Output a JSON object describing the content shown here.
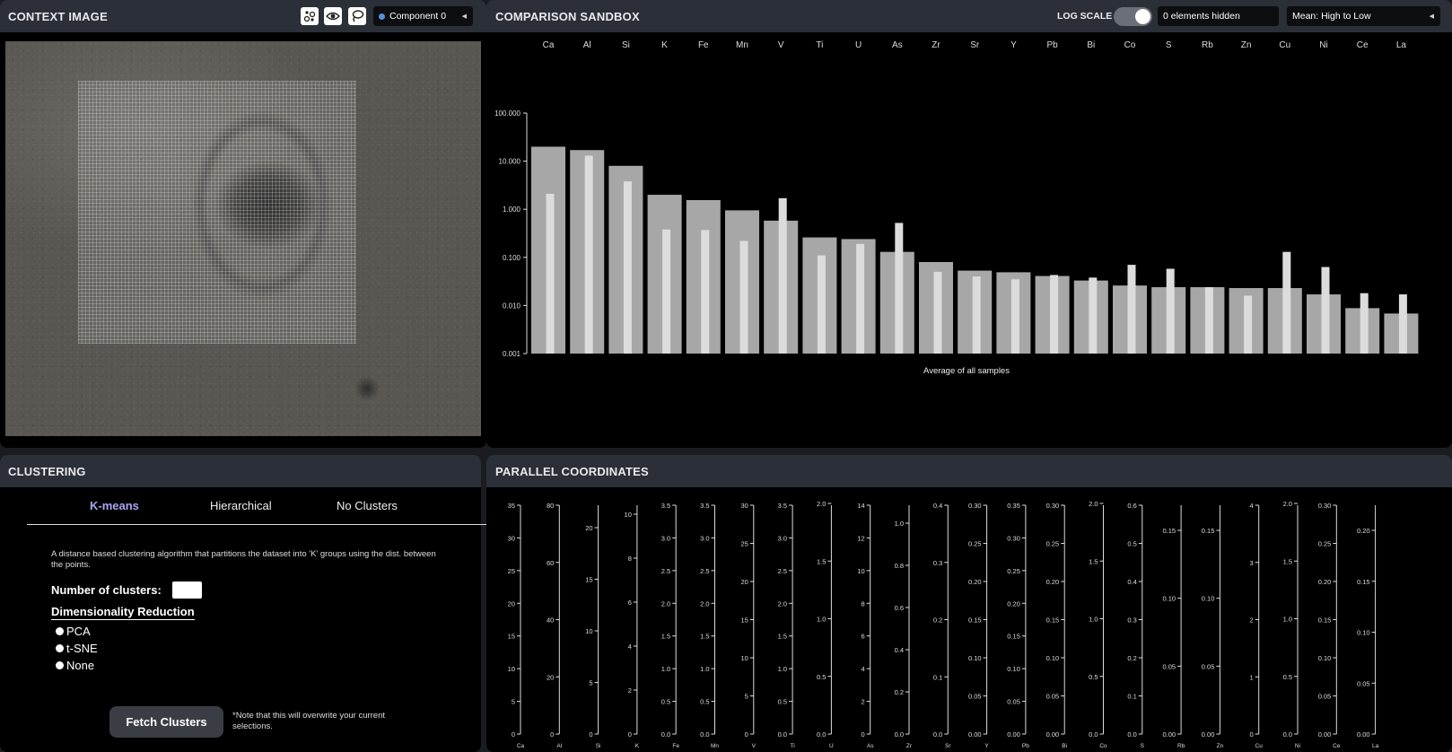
{
  "context": {
    "title": "CONTEXT IMAGE",
    "component_select": "Component 0",
    "icons": [
      "points-icon",
      "eye-icon",
      "lasso-icon"
    ]
  },
  "sandbox": {
    "title": "COMPARISON SANDBOX",
    "log_scale_label": "LOG SCALE",
    "log_scale_on": true,
    "hidden_count": "0 elements hidden",
    "sort_select": "Mean: High to Low"
  },
  "clustering": {
    "title": "CLUSTERING",
    "tabs": [
      "K-means",
      "Hierarchical",
      "No Clusters"
    ],
    "active_tab": "K-means",
    "description": "A distance based clustering algorithm that partitions the dataset into 'K' groups using the dist. between the points.",
    "num_clusters_label": "Number of clusters:",
    "num_clusters_value": "",
    "dim_reduction_label": "Dimensionality Reduction",
    "dim_options": [
      "PCA",
      "t-SNE",
      "None"
    ],
    "fetch_button": "Fetch Clusters",
    "note": "*Note that this will overwrite your current selections."
  },
  "parallel": {
    "title": "PARALLEL COORDINATES"
  },
  "chart_data": [
    {
      "type": "bar",
      "scale": "log",
      "categories": [
        "Ca",
        "Al",
        "Si",
        "K",
        "Fe",
        "Mn",
        "V",
        "Ti",
        "U",
        "As",
        "Zr",
        "Sr",
        "Y",
        "Pb",
        "Bi",
        "Co",
        "S",
        "Rb",
        "Zn",
        "Cu",
        "Ni",
        "Ce",
        "La"
      ],
      "series": [
        {
          "values": [
            20.0,
            17.0,
            8.0,
            2.0,
            1.55,
            0.95,
            0.58,
            0.26,
            0.24,
            0.13,
            0.08,
            0.053,
            0.049,
            0.041,
            0.033,
            0.026,
            0.024,
            0.024,
            0.023,
            0.023,
            0.017,
            0.0088,
            0.0068
          ]
        },
        {
          "values": [
            2.1,
            13.0,
            3.8,
            0.38,
            0.37,
            0.22,
            1.7,
            0.11,
            0.19,
            0.52,
            0.05,
            0.04,
            0.035,
            0.043,
            0.038,
            0.07,
            0.058,
            0.024,
            0.016,
            0.13,
            0.063,
            0.018,
            0.017
          ]
        }
      ],
      "yticks": [
        "100.000",
        "10.000",
        "1.000",
        "0.100",
        "0.010",
        "0.001"
      ],
      "ylim": [
        0.001,
        100
      ],
      "xlabel": "Average of all samples",
      "colors": {
        "bar": "#a7a7a7",
        "inner_bar": "#dcdcdc"
      }
    },
    {
      "type": "parallel-coordinates",
      "axes": [
        {
          "name": "Ca",
          "ticks": [
            "35",
            "30",
            "25",
            "20",
            "15",
            "10",
            "5",
            "0"
          ]
        },
        {
          "name": "Al",
          "ticks": [
            "80",
            "60",
            "40",
            "20",
            "0"
          ]
        },
        {
          "name": "Si",
          "ticks": [
            "20",
            "15",
            "10",
            "5",
            "0"
          ]
        },
        {
          "name": "K",
          "ticks": [
            "10",
            "8",
            "6",
            "4",
            "2",
            "0"
          ]
        },
        {
          "name": "Fe",
          "ticks": [
            "3.5",
            "3.0",
            "2.5",
            "2.0",
            "1.5",
            "1.0",
            "0.5",
            "0.0"
          ]
        },
        {
          "name": "Mn",
          "ticks": [
            "3.5",
            "3.0",
            "2.5",
            "2.0",
            "1.5",
            "1.0",
            "0.5",
            "0.0"
          ]
        },
        {
          "name": "V",
          "ticks": [
            "30",
            "25",
            "20",
            "15",
            "10",
            "5",
            "0"
          ]
        },
        {
          "name": "Ti",
          "ticks": [
            "3.5",
            "3.0",
            "2.5",
            "2.0",
            "1.5",
            "1.0",
            "0.5",
            "0.0"
          ]
        },
        {
          "name": "U",
          "ticks": [
            "2.0",
            "1.5",
            "1.0",
            "0.5",
            "0.0"
          ]
        },
        {
          "name": "As",
          "ticks": [
            "14",
            "12",
            "10",
            "8",
            "6",
            "4",
            "2",
            "0"
          ]
        },
        {
          "name": "Zr",
          "ticks": [
            "1.0",
            "0.8",
            "0.6",
            "0.4",
            "0.2",
            "0.0"
          ]
        },
        {
          "name": "Sr",
          "ticks": [
            "0.4",
            "0.3",
            "0.2",
            "0.1",
            "0.0"
          ]
        },
        {
          "name": "Y",
          "ticks": [
            "0.30",
            "0.25",
            "0.20",
            "0.15",
            "0.10",
            "0.05",
            "0.00"
          ]
        },
        {
          "name": "Pb",
          "ticks": [
            "0.35",
            "0.30",
            "0.25",
            "0.20",
            "0.15",
            "0.10",
            "0.05",
            "0.00"
          ]
        },
        {
          "name": "Bi",
          "ticks": [
            "0.30",
            "0.25",
            "0.20",
            "0.15",
            "0.10",
            "0.05",
            "0.00"
          ]
        },
        {
          "name": "Co",
          "ticks": [
            "2.0",
            "1.5",
            "1.0",
            "0.5",
            "0.0"
          ]
        },
        {
          "name": "S",
          "ticks": [
            "0.6",
            "0.5",
            "0.4",
            "0.3",
            "0.2",
            "0.1",
            "0.0"
          ]
        },
        {
          "name": "Rb",
          "ticks": [
            "0.15",
            "0.10",
            "0.05",
            "0.00"
          ]
        },
        {
          "name": "Zn",
          "ticks": [
            "0.15",
            "0.10",
            "0.05",
            "0.00"
          ]
        },
        {
          "name": "Cu",
          "ticks": [
            "4",
            "3",
            "2",
            "1",
            "0"
          ]
        },
        {
          "name": "Ni",
          "ticks": [
            "2.0",
            "1.5",
            "1.0",
            "0.5",
            "0.0"
          ]
        },
        {
          "name": "Ce",
          "ticks": [
            "0.30",
            "0.25",
            "0.20",
            "0.15",
            "0.10",
            "0.05",
            "0.00"
          ]
        },
        {
          "name": "La",
          "ticks": [
            "0.20",
            "0.15",
            "0.10",
            "0.05",
            "0.00"
          ]
        }
      ]
    }
  ]
}
